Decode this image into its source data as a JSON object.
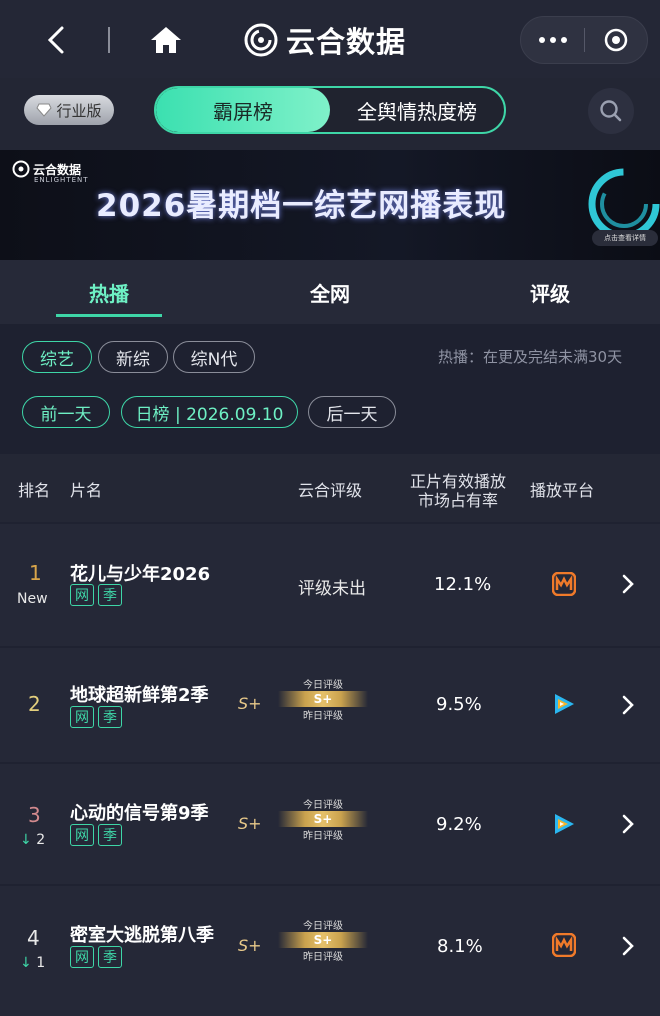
{
  "topbar": {
    "brand": "云合数据"
  },
  "subbar": {
    "badge": "行业版",
    "seg_active": "霸屏榜",
    "seg_other": "全舆情热度榜"
  },
  "banner": {
    "logo_text": "云合数据",
    "logo_sub": "ENLIGHTENT",
    "title": "2026暑期档一综艺网播表现",
    "cta": "点击查看详情"
  },
  "tabs": [
    "热播",
    "全网",
    "评级"
  ],
  "filters": {
    "genre": [
      "综艺",
      "新综",
      "综N代"
    ],
    "note": "热播：在更及完结未满30天",
    "prev": "前一天",
    "date": "日榜 | 2026.09.10",
    "next": "后一天"
  },
  "table": {
    "headers": {
      "rank": "排名",
      "title": "片名",
      "grade": "云合评级",
      "share_line1": "正片有效播放",
      "share_line2": "市场占有率",
      "platform": "播放平台"
    },
    "today_label": "今日评级",
    "yesterday_label": "昨日评级",
    "rows": [
      {
        "rank": "1",
        "change": "New",
        "title": "花儿与少年2026",
        "tags": [
          "网",
          "季"
        ],
        "grade_text": "评级未出",
        "share": "12.1%",
        "platform": "mango-tv-icon",
        "rank_color": "#d9a54a"
      },
      {
        "rank": "2",
        "change": "",
        "title": "地球超新鲜第2季",
        "tags": [
          "网",
          "季"
        ],
        "grade": "S+",
        "grade_today": "S+",
        "share": "9.5%",
        "platform": "tencent-video-icon",
        "rank_color": "#e3cf7d"
      },
      {
        "rank": "3",
        "change": "2",
        "title": "心动的信号第9季",
        "tags": [
          "网",
          "季"
        ],
        "grade": "S+",
        "grade_today": "S+",
        "share": "9.2%",
        "platform": "tencent-video-icon",
        "rank_color": "#d38a8e"
      },
      {
        "rank": "4",
        "change": "1",
        "title": "密室大逃脱第八季",
        "tags": [
          "网",
          "季"
        ],
        "grade": "S+",
        "grade_today": "S+",
        "share": "8.1%",
        "platform": "mango-tv-icon",
        "rank_color": "#e8e8e8"
      }
    ]
  }
}
